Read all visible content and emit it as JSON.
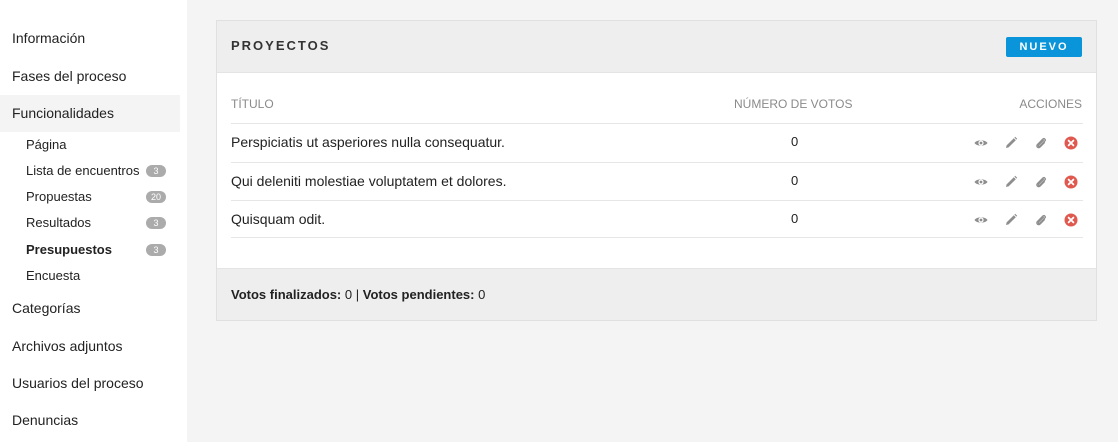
{
  "sidebar": {
    "items": [
      {
        "label": "Información"
      },
      {
        "label": "Fases del proceso"
      },
      {
        "label": "Funcionalidades"
      },
      {
        "label": "Categorías"
      },
      {
        "label": "Archivos adjuntos"
      },
      {
        "label": "Usuarios del proceso"
      },
      {
        "label": "Denuncias"
      }
    ],
    "subitems": [
      {
        "label": "Página",
        "badge": ""
      },
      {
        "label": "Lista de encuentros",
        "badge": "3"
      },
      {
        "label": "Propuestas",
        "badge": "20"
      },
      {
        "label": "Resultados",
        "badge": "3"
      },
      {
        "label": "Presupuestos",
        "badge": "3"
      },
      {
        "label": "Encuesta",
        "badge": ""
      }
    ]
  },
  "card": {
    "title": "PROYECTOS",
    "new_label": "NUEVO",
    "columns": {
      "title": "Título",
      "votes": "Número de votos",
      "actions": "Acciones"
    },
    "rows": [
      {
        "title": "Perspiciatis ut asperiores nulla consequatur.",
        "votes": "0"
      },
      {
        "title": "Qui deleniti molestiae voluptatem et dolores.",
        "votes": "0"
      },
      {
        "title": "Quisquam odit.",
        "votes": "0"
      }
    ],
    "footer": {
      "finished_label": "Votos finalizados:",
      "finished_value": "0",
      "separator": "|",
      "pending_label": "Votos pendientes:",
      "pending_value": "0"
    }
  },
  "icons": {
    "view": "eye-icon",
    "edit": "pencil-icon",
    "attach": "paperclip-icon",
    "delete": "close-circle-icon"
  },
  "colors": {
    "accent": "#0a94d9",
    "danger": "#e0594f",
    "icon": "#8e8e8e"
  }
}
